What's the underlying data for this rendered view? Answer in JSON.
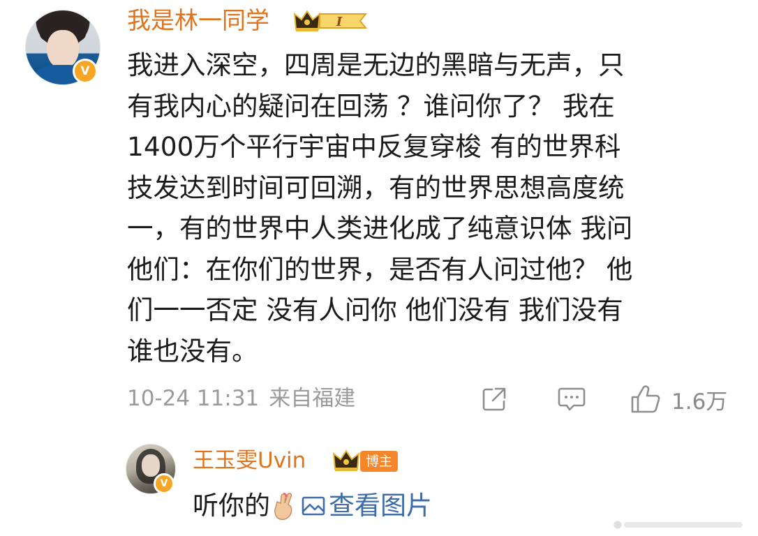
{
  "main_comment": {
    "username": "我是林一同学",
    "verified_mark": "V",
    "level_badge": "I",
    "text_lines": [
      "我进入深空，四周是无边的黑暗与无声，只",
      "有我内心的疑问在回荡 ？谁问你了？ 我在",
      "1400万个平行宇宙中反复穿梭 有的世界科",
      "技发达到时间可回溯，有的世界思想高度统",
      "一，有的世界中人类进化成了纯意识体 我问",
      "他们：在你们的世界，是否有人问过他？ 他",
      "们一一否定 没有人问你 他们没有 我们没有",
      "谁也没有。"
    ],
    "timestamp": "10-24 11:31",
    "location": "来自福建",
    "like_count": "1.6万",
    "icons": {
      "share": "share-icon",
      "reply": "comment-icon",
      "like": "thumbs-up-icon"
    }
  },
  "reply": {
    "username": "王玉雯Uvin",
    "verified_mark": "V",
    "tag": "博主",
    "text": "听你的",
    "emoji": "crossed-fingers-emoji",
    "link_label": "查看图片",
    "link_icon": "image-icon"
  },
  "colors": {
    "username": "#e0731d",
    "link": "#3e6cab",
    "meta": "#9a9a9a",
    "verified": "#f6a623",
    "tag": "#f5862b"
  }
}
